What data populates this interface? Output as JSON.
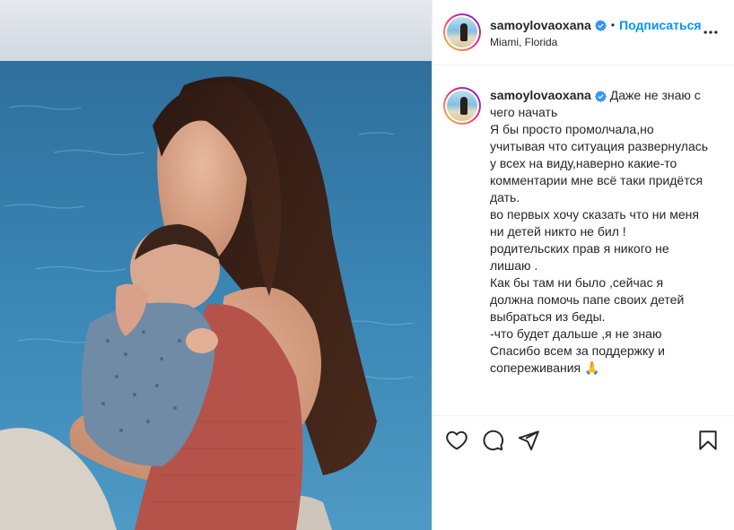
{
  "post": {
    "username": "samoylovaoxana",
    "location": "Miami, Florida",
    "follow_label": "Подписаться",
    "separator": "•",
    "caption": {
      "first_line": "Даже не знаю с",
      "lines": [
        "чего начать",
        "Я бы просто промолчала,но",
        "учитывая что ситуация развернулась",
        "у всех на виду,наверно какие-то",
        "комментарии мне всё таки придётся",
        "дать.",
        "во первых хочу сказать что ни меня",
        "ни детей никто не бил !",
        "родительских прав я никого не",
        "лишаю .",
        "Как бы там ни было ,сейчас я",
        "должна помочь папе своих детей",
        "выбраться из беды.",
        "-что будет дальше ,я не знаю",
        "Спасибо всем за поддержку и",
        "сопереживания 🙏"
      ]
    }
  },
  "colors": {
    "follow": "#0095f6",
    "verified": "#3897f0",
    "text": "#262626",
    "border": "#efefef"
  },
  "icons": {
    "header": [
      "verified-badge-icon",
      "more-options-icon"
    ],
    "actions": [
      "like-heart-icon",
      "comment-bubble-icon",
      "share-paper-plane-icon",
      "save-bookmark-icon"
    ]
  }
}
